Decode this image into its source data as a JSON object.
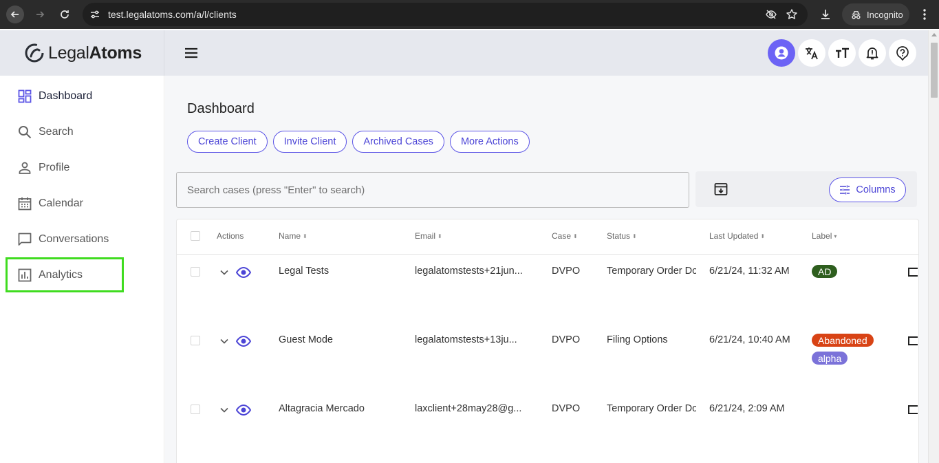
{
  "browser": {
    "url": "test.legalatoms.com/a/l/clients",
    "incognito_label": "Incognito"
  },
  "app": {
    "logo_light": "Legal",
    "logo_bold": "Atoms"
  },
  "sidebar": {
    "items": [
      {
        "label": "Dashboard",
        "icon": "dashboard-icon",
        "active": true
      },
      {
        "label": "Search",
        "icon": "search-icon"
      },
      {
        "label": "Profile",
        "icon": "person-icon"
      },
      {
        "label": "Calendar",
        "icon": "calendar-icon"
      },
      {
        "label": "Conversations",
        "icon": "chat-icon"
      },
      {
        "label": "Analytics",
        "icon": "analytics-icon"
      }
    ]
  },
  "main": {
    "title": "Dashboard",
    "buttons": [
      "Create Client",
      "Invite Client",
      "Archived Cases",
      "More Actions"
    ],
    "search_placeholder": "Search cases (press \"Enter\" to search)",
    "columns_label": "Columns"
  },
  "table": {
    "headers": [
      "Actions",
      "Name",
      "Email",
      "Case",
      "Status",
      "Last Updated",
      "Label"
    ],
    "rows": [
      {
        "name": "Legal Tests",
        "email": "legalatomstests+21jun...",
        "case": "DVPO",
        "status": "Temporary Order Do",
        "updated": "6/21/24, 11:32 AM",
        "labels": [
          "AD"
        ]
      },
      {
        "name": "Guest Mode",
        "email": "legalatomstests+13ju...",
        "case": "DVPO",
        "status": "Filing Options",
        "updated": "6/21/24, 10:40 AM",
        "labels": [
          "Abandoned",
          "alpha"
        ]
      },
      {
        "name": "Altagracia Mercado",
        "email": "laxclient+28may28@g...",
        "case": "DVPO",
        "status": "Temporary Order Do",
        "updated": "6/21/24, 2:09 AM",
        "labels": []
      }
    ]
  },
  "colors": {
    "accent": "#5b54e6",
    "badge_ad": "#2e5e1e",
    "badge_abandoned": "#d84315",
    "badge_alpha": "#7b72d9",
    "highlight": "#3fdc1f"
  }
}
